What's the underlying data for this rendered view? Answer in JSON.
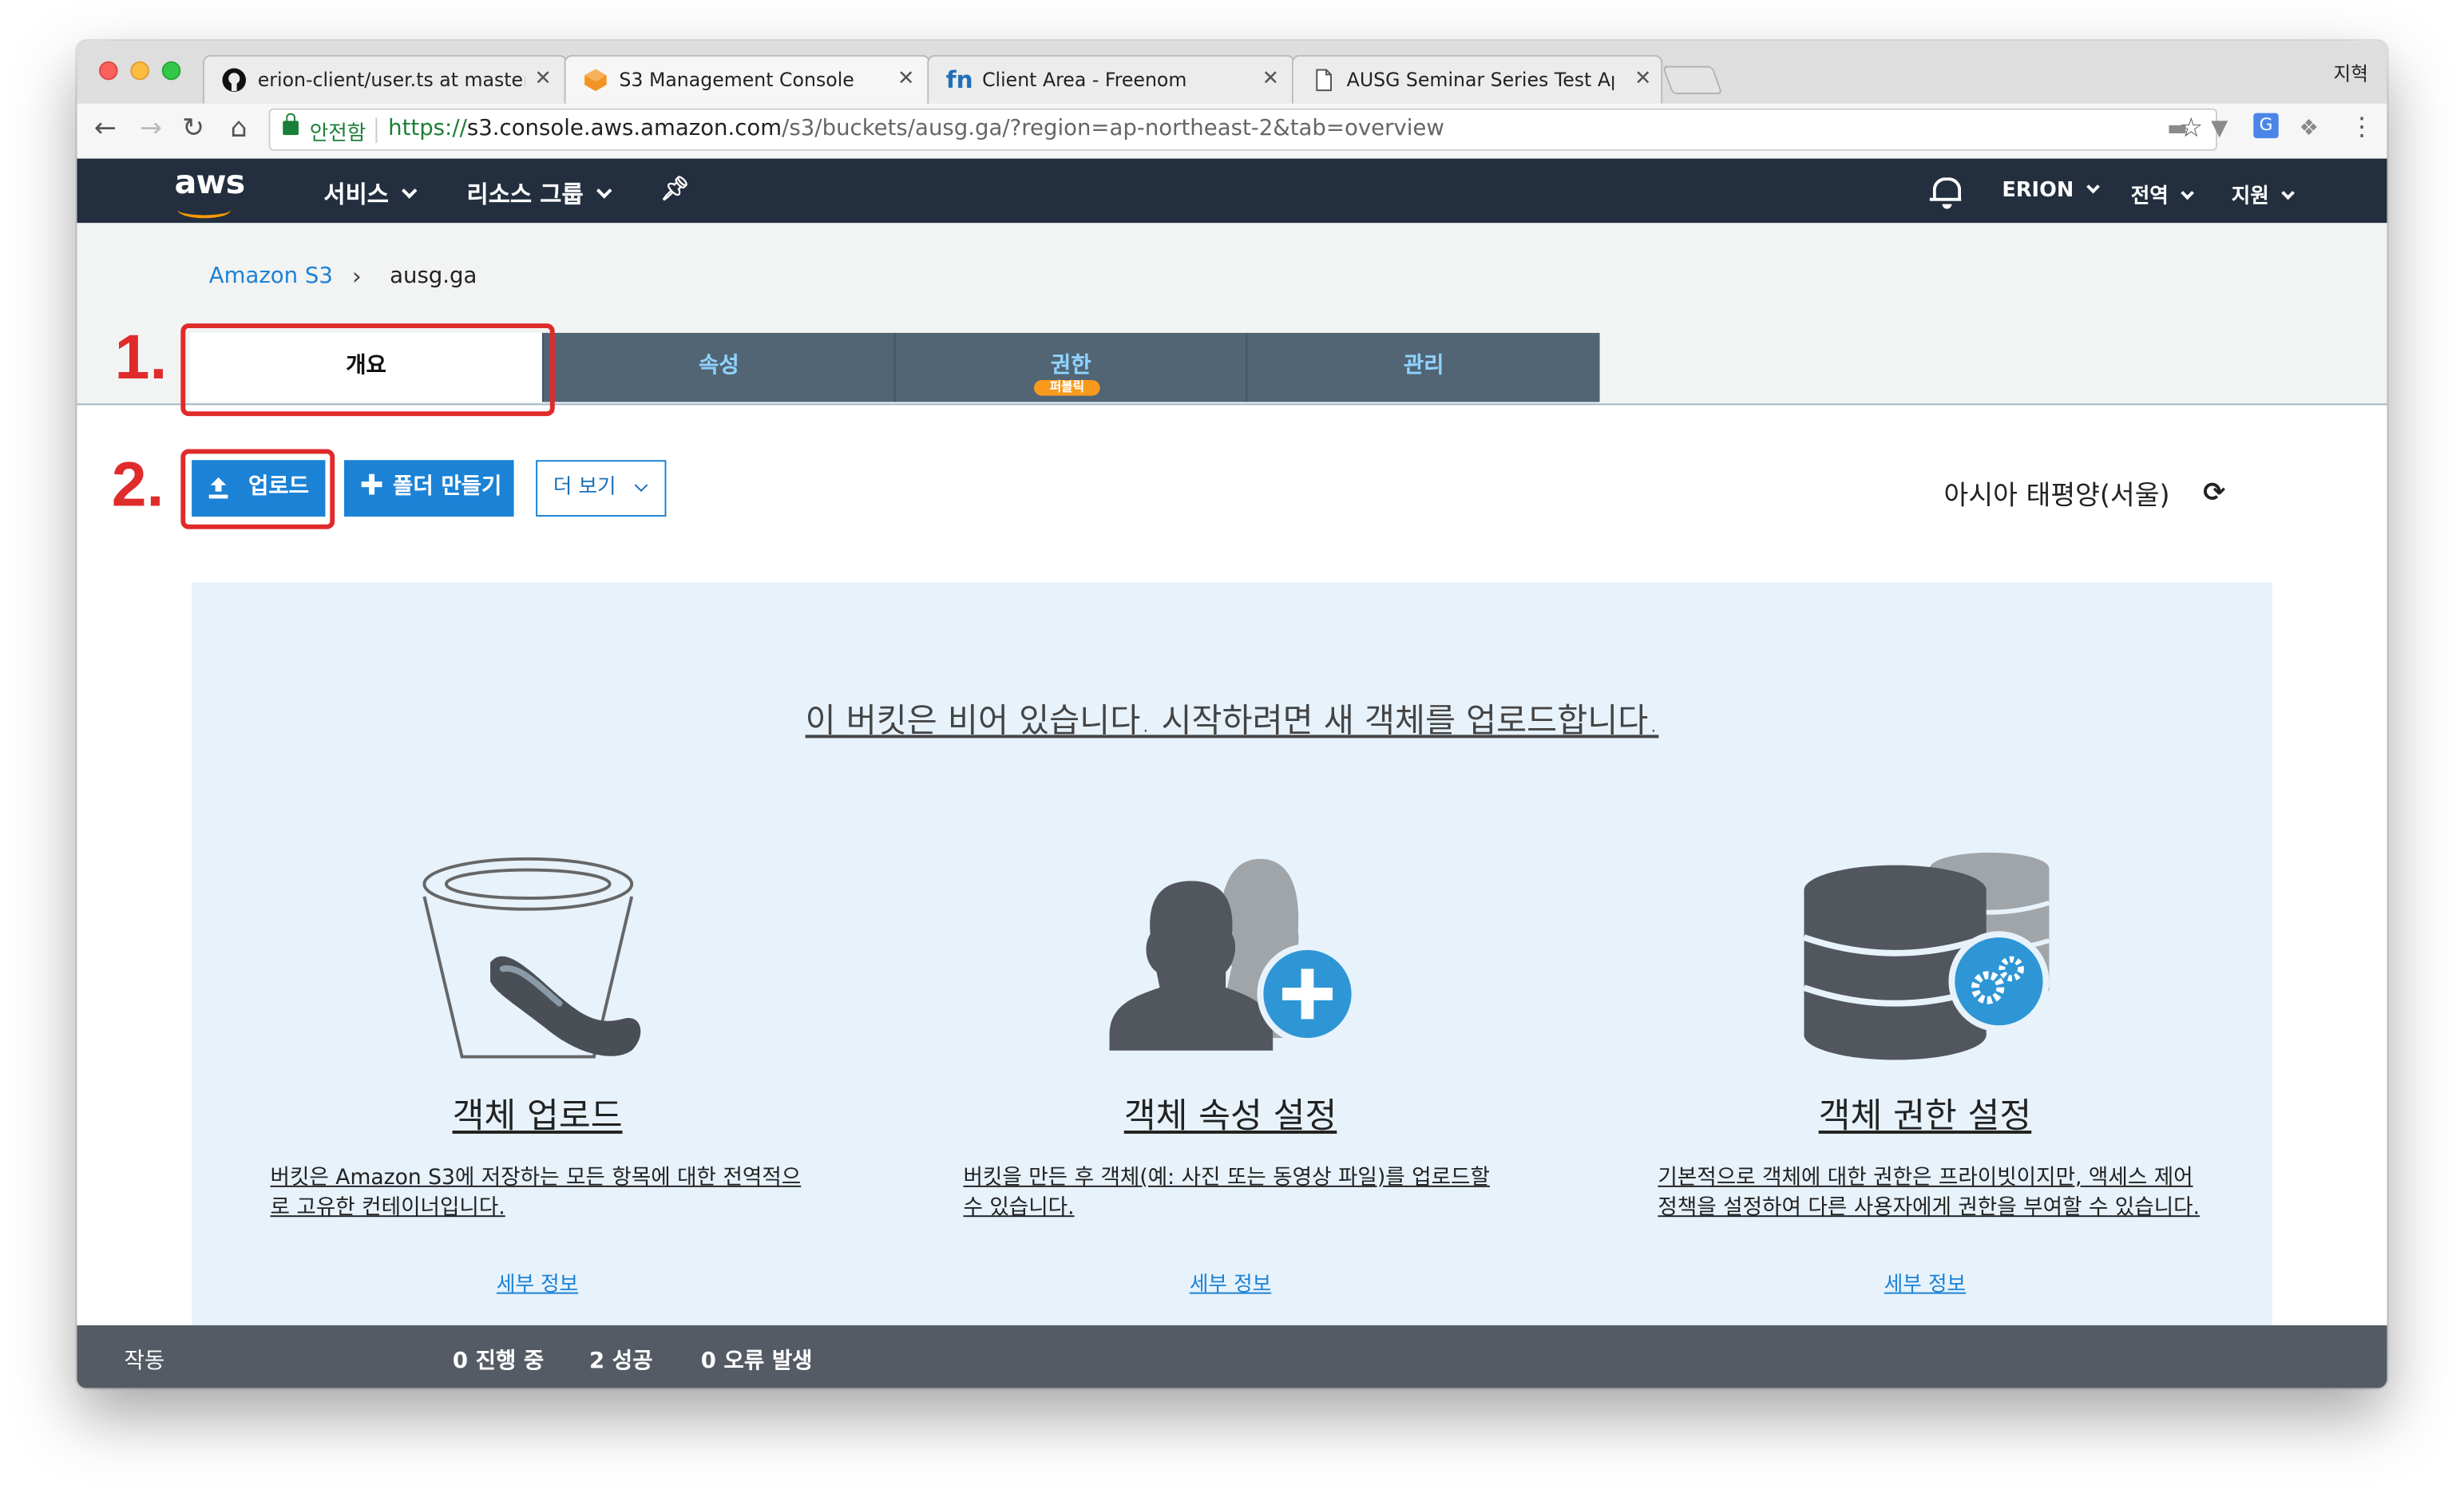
{
  "browser": {
    "profile_name": "지혁",
    "tabs": [
      {
        "title": "erion-client/user.ts at master ·",
        "icon": "github-icon",
        "active": false
      },
      {
        "title": "S3 Management Console",
        "icon": "aws-s3-icon",
        "active": true
      },
      {
        "title": "Client Area - Freenom",
        "icon": "freenom-icon",
        "active": false
      },
      {
        "title": "AUSG Seminar Series Test App",
        "icon": "document-icon",
        "active": false
      }
    ],
    "secure_label": "안전함",
    "url_scheme": "https://",
    "url_host": "s3.console.aws.amazon.com",
    "url_path": "/s3/buckets/ausg.ga/?region=ap-northeast-2&tab=overview"
  },
  "aws_nav": {
    "logo": "aws",
    "services": "서비스",
    "resource_groups": "리소스 그룹",
    "account": "ERION",
    "region": "전역",
    "support": "지원"
  },
  "breadcrumb": {
    "root": "Amazon S3",
    "separator": "›",
    "bucket": "ausg.ga"
  },
  "tabs": [
    {
      "label": "개요",
      "active": true
    },
    {
      "label": "속성",
      "active": false
    },
    {
      "label": "권한",
      "active": false,
      "badge": "퍼블릭"
    },
    {
      "label": "관리",
      "active": false
    }
  ],
  "annotations": {
    "step1": "1.",
    "step2": "2."
  },
  "actions": {
    "upload": "업로드",
    "create_folder": "폴더 만들기",
    "more": "더 보기"
  },
  "region_display": "아시아 태평양(서울)",
  "empty_state": {
    "message": "이 버킷은 비어 있습니다. 시작하려면 새 객체를 업로드합니다.",
    "columns": [
      {
        "title": "객체 업로드",
        "desc_line1": "버킷은 Amazon S3에 저장하는 모든 항목에 대한 전역적으",
        "desc_line2": "로 고유한 컨테이너입니다.",
        "link": "세부 정보",
        "icon": "bucket-icon"
      },
      {
        "title": "객체 속성 설정",
        "desc_line1": "버킷을 만든 후 객체(예: 사진 또는 동영상 파일)를 업로드할",
        "desc_line2": "수 있습니다.",
        "link": "세부 정보",
        "icon": "users-add-icon"
      },
      {
        "title": "객체 권한 설정",
        "desc_line1": "기본적으로 객체에 대한 권한은 프라이빗이지만, 액세스 제어",
        "desc_line2": "정책을 설정하여 다른 사용자에게 권한을 부여할 수 있습니다.",
        "link": "세부 정보",
        "icon": "database-gear-icon"
      }
    ]
  },
  "status_bar": {
    "label": "작동",
    "in_progress": "0 진행 중",
    "success": "2 성공",
    "errors": "0 오류 발생"
  },
  "colors": {
    "aws_nav_bg": "#232f3e",
    "tab_bg": "#516575",
    "primary_button": "#1b82d6",
    "annotation_red": "#e02b2b",
    "panel_bg": "#e7f2fb",
    "status_bar_bg": "#545b64"
  }
}
